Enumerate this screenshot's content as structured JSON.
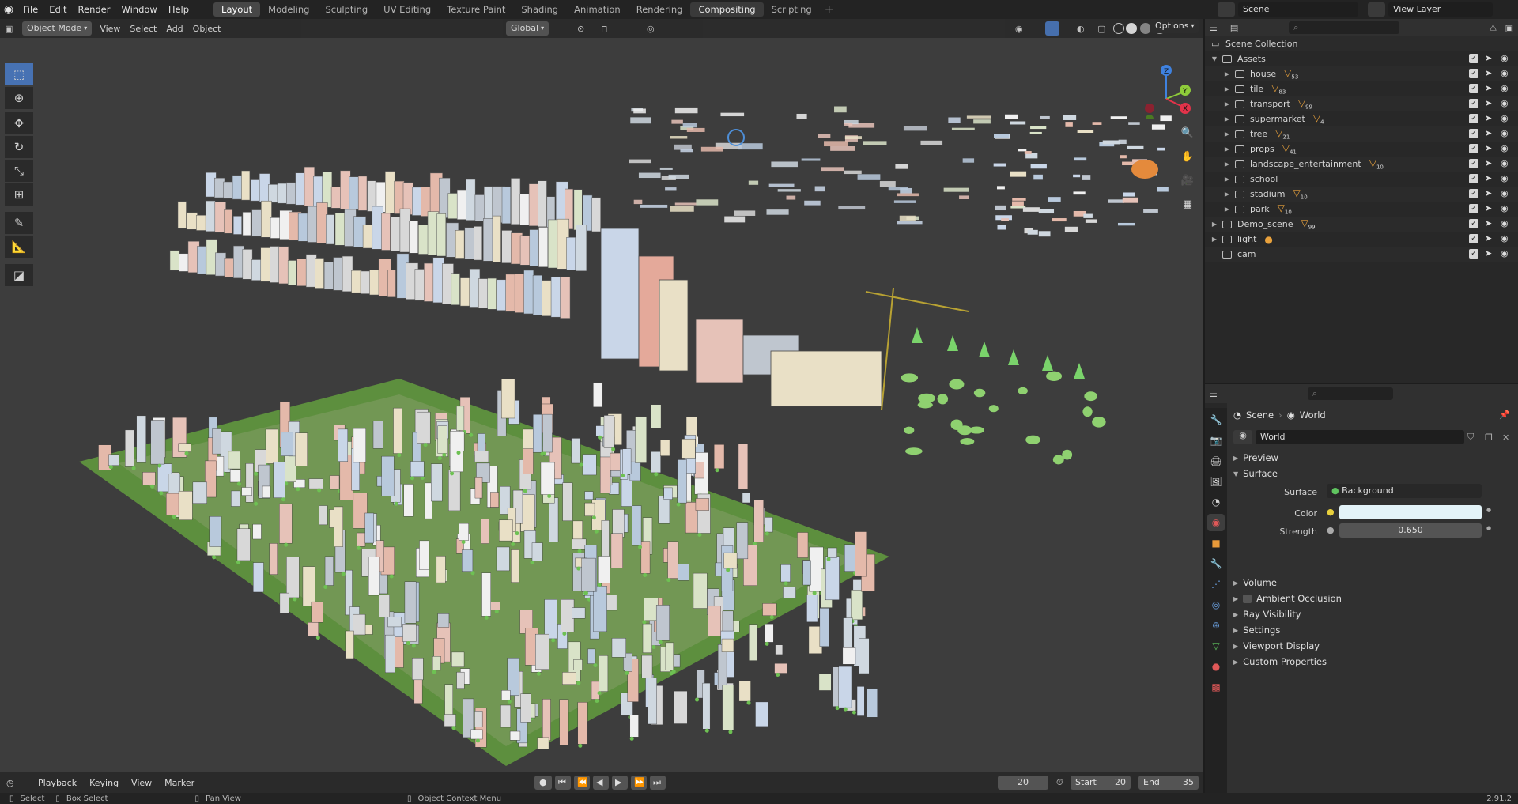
{
  "menu": [
    "File",
    "Edit",
    "Render",
    "Window",
    "Help"
  ],
  "workspace_tabs": [
    "Layout",
    "Modeling",
    "Sculpting",
    "UV Editing",
    "Texture Paint",
    "Shading",
    "Animation",
    "Rendering",
    "Compositing",
    "Scripting"
  ],
  "scene_name": "Scene",
  "view_layer": "View Layer",
  "viewport": {
    "mode": "Object Mode",
    "menus": [
      "View",
      "Select",
      "Add",
      "Object"
    ],
    "orientation": "Global",
    "options": "Options"
  },
  "gizmo": {
    "x": "X",
    "y": "Y",
    "z": "Z"
  },
  "timeline": {
    "menus": [
      "Playback",
      "Keying",
      "View",
      "Marker"
    ],
    "current_frame": "20",
    "start_label": "Start",
    "start": "20",
    "end_label": "End",
    "end": "35"
  },
  "status": {
    "select": "Select",
    "box_select": "Box Select",
    "pan_view": "Pan View",
    "context_menu": "Object Context Menu",
    "version": "2.91.2"
  },
  "outliner": {
    "root": "Scene Collection",
    "rows": [
      {
        "name": "Assets",
        "count": ""
      },
      {
        "name": "house",
        "count": "53"
      },
      {
        "name": "tile",
        "count": "83"
      },
      {
        "name": "transport",
        "count": "99"
      },
      {
        "name": "supermarket",
        "count": "4"
      },
      {
        "name": "tree",
        "count": "21"
      },
      {
        "name": "props",
        "count": "41"
      },
      {
        "name": "landscape_entertainment",
        "count": "10"
      },
      {
        "name": "school",
        "count": ""
      },
      {
        "name": "stadium",
        "count": "10"
      },
      {
        "name": "park",
        "count": "10"
      },
      {
        "name": "Demo_scene",
        "count": "99"
      },
      {
        "name": "light",
        "count": ""
      },
      {
        "name": "cam",
        "count": ""
      }
    ]
  },
  "properties": {
    "breadcrumb_scene": "Scene",
    "breadcrumb_world": "World",
    "world_name": "World",
    "sections": [
      "Preview",
      "Surface",
      "Volume",
      "Ambient Occlusion",
      "Ray Visibility",
      "Settings",
      "Viewport Display",
      "Custom Properties"
    ],
    "surface_label": "Surface",
    "surface_value": "Background",
    "color_label": "Color",
    "color_value": "#e3f3f8",
    "strength_label": "Strength",
    "strength_value": "0.650"
  }
}
